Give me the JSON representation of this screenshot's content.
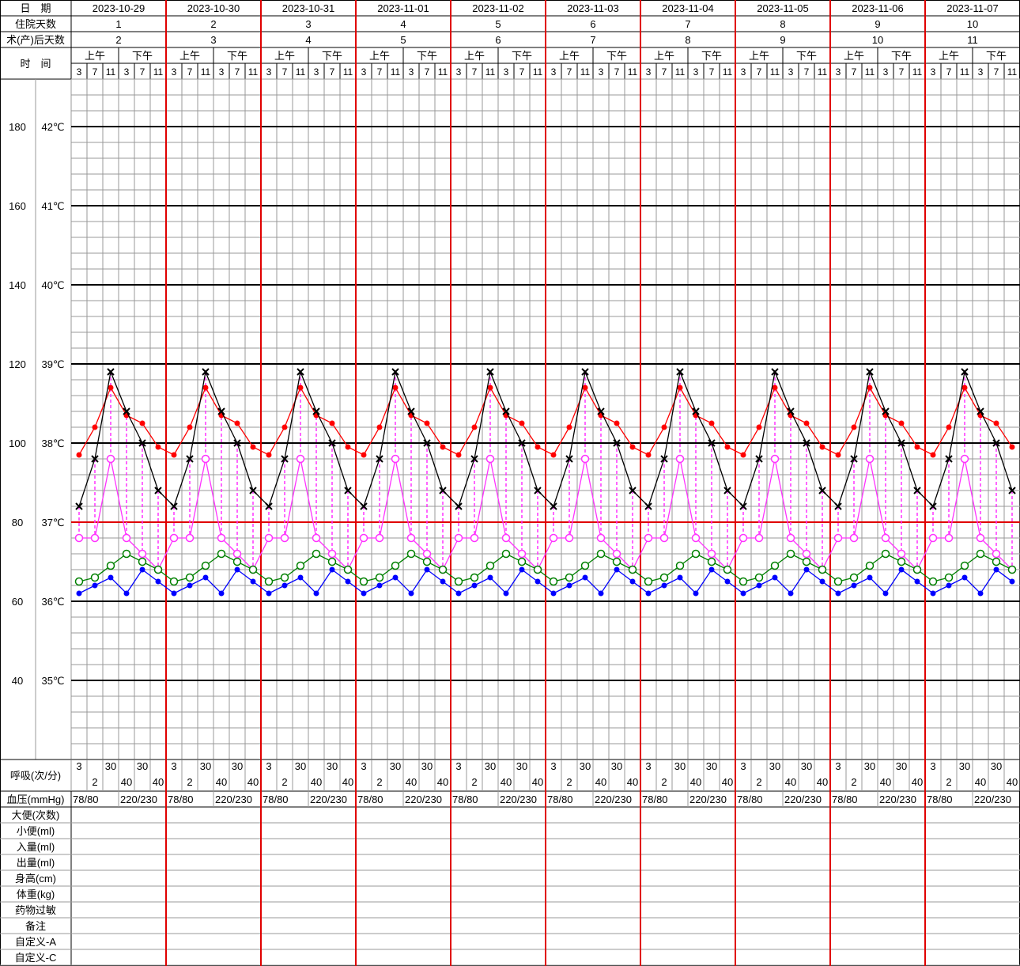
{
  "header": {
    "date_label": "日　期",
    "hosp_days_label": "住院天数",
    "postop_days_label": "术(产)后天数",
    "time_label": "时　间",
    "am_label": "上午",
    "pm_label": "下午",
    "hours": [
      "3",
      "7",
      "11",
      "3",
      "7",
      "11"
    ]
  },
  "days": [
    {
      "date": "2023-10-29",
      "hosp": "1",
      "postop": "2"
    },
    {
      "date": "2023-10-30",
      "hosp": "2",
      "postop": "3"
    },
    {
      "date": "2023-10-31",
      "hosp": "3",
      "postop": "4"
    },
    {
      "date": "2023-11-01",
      "hosp": "4",
      "postop": "5"
    },
    {
      "date": "2023-11-02",
      "hosp": "5",
      "postop": "6"
    },
    {
      "date": "2023-11-03",
      "hosp": "6",
      "postop": "7"
    },
    {
      "date": "2023-11-04",
      "hosp": "7",
      "postop": "8"
    },
    {
      "date": "2023-11-05",
      "hosp": "8",
      "postop": "9"
    },
    {
      "date": "2023-11-06",
      "hosp": "9",
      "postop": "10"
    },
    {
      "date": "2023-11-07",
      "hosp": "10",
      "postop": "11"
    }
  ],
  "axis": {
    "pulse_labels": [
      "180",
      "160",
      "140",
      "120",
      "100",
      "80",
      "60",
      "40"
    ],
    "temp_labels": [
      "42℃",
      "41℃",
      "40℃",
      "39℃",
      "38℃",
      "37℃",
      "36℃",
      "35℃"
    ]
  },
  "chart_data": {
    "type": "line",
    "x_slots": [
      "3",
      "7",
      "11",
      "3",
      "7",
      "11"
    ],
    "temp_range": [
      34,
      43
    ],
    "pulse_range": [
      20,
      200
    ],
    "series": [
      {
        "key": "red",
        "color": "#ff0000",
        "axis": "pulse",
        "marker": "dot",
        "values": [
          97,
          104,
          114,
          107,
          105,
          99
        ]
      },
      {
        "key": "black",
        "color": "#000000",
        "axis": "temp",
        "marker": "x",
        "values": [
          37.2,
          37.8,
          38.9,
          38.4,
          38.0,
          37.4
        ]
      },
      {
        "key": "magenta",
        "color": "#ff33ff",
        "axis": "temp",
        "marker": "circle",
        "values": [
          36.8,
          36.8,
          37.8,
          36.8,
          36.6,
          36.4
        ]
      },
      {
        "key": "green",
        "color": "#008000",
        "axis": "temp",
        "marker": "circle",
        "values": [
          36.25,
          36.3,
          36.45,
          36.6,
          36.5,
          36.4
        ]
      },
      {
        "key": "blue",
        "color": "#0000ff",
        "axis": "temp",
        "marker": "dot",
        "values": [
          36.1,
          36.2,
          36.3,
          36.1,
          36.4,
          36.25
        ]
      }
    ],
    "dashed_links": [
      [
        0,
        0
      ],
      [
        1,
        1
      ],
      [
        2,
        2
      ],
      [
        3,
        3
      ],
      [
        4,
        4
      ],
      [
        5,
        5
      ]
    ]
  },
  "resp": {
    "label": "呼吸(次/分)",
    "top": [
      "3",
      "",
      "30",
      "30",
      "",
      ""
    ],
    "bottom": [
      "",
      "2",
      "",
      "40",
      "",
      "40"
    ],
    "top_b": [
      "3",
      "",
      "30",
      "",
      "30",
      ""
    ],
    "values_top": [
      "3",
      "30",
      "30"
    ],
    "values_bottom": [
      "2",
      "40",
      "40"
    ]
  },
  "bp": {
    "label": "血压(mmHg)",
    "am": "78/80",
    "pm": "220/230"
  },
  "bottom_rows": [
    "大便(次数)",
    "小便(ml)",
    "入量(ml)",
    "出量(ml)",
    "身高(cm)",
    "体重(kg)",
    "药物过敏",
    "备注",
    "自定义-A",
    "自定义-C"
  ]
}
